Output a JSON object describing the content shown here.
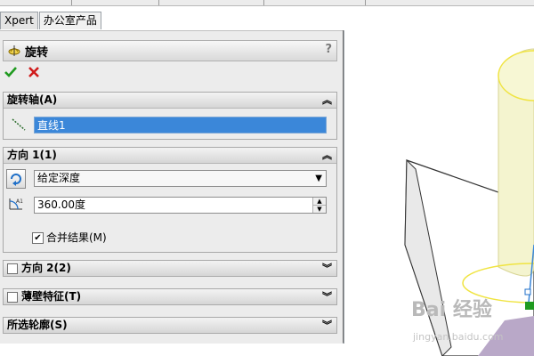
{
  "tabs": [
    {
      "label": "Xpert"
    },
    {
      "label": "办公室产品"
    }
  ],
  "panel": {
    "title": "旋转",
    "help": "?",
    "ok_icon": "green-check-icon",
    "cancel_icon": "red-x-icon"
  },
  "sections": {
    "axis": {
      "header": "旋转轴(A)",
      "field_value": "直线1"
    },
    "direction1": {
      "header": "方向 1(1)",
      "type_value": "给定深度",
      "angle_value": "360.00度",
      "merge_label": "合并结果(M)",
      "merge_checked": true
    },
    "direction2": {
      "header": "方向 2(2)"
    },
    "thin": {
      "header": "薄壁特征(T)"
    },
    "contours": {
      "header": "所选轮廓(S)"
    }
  },
  "watermark": {
    "text": "Bai 经验",
    "url_text": "jingyan.baidu.com"
  },
  "colors": {
    "selection": "#3b87d9",
    "model_fill": "#f4f4cf",
    "sketch": "#f0e442"
  }
}
